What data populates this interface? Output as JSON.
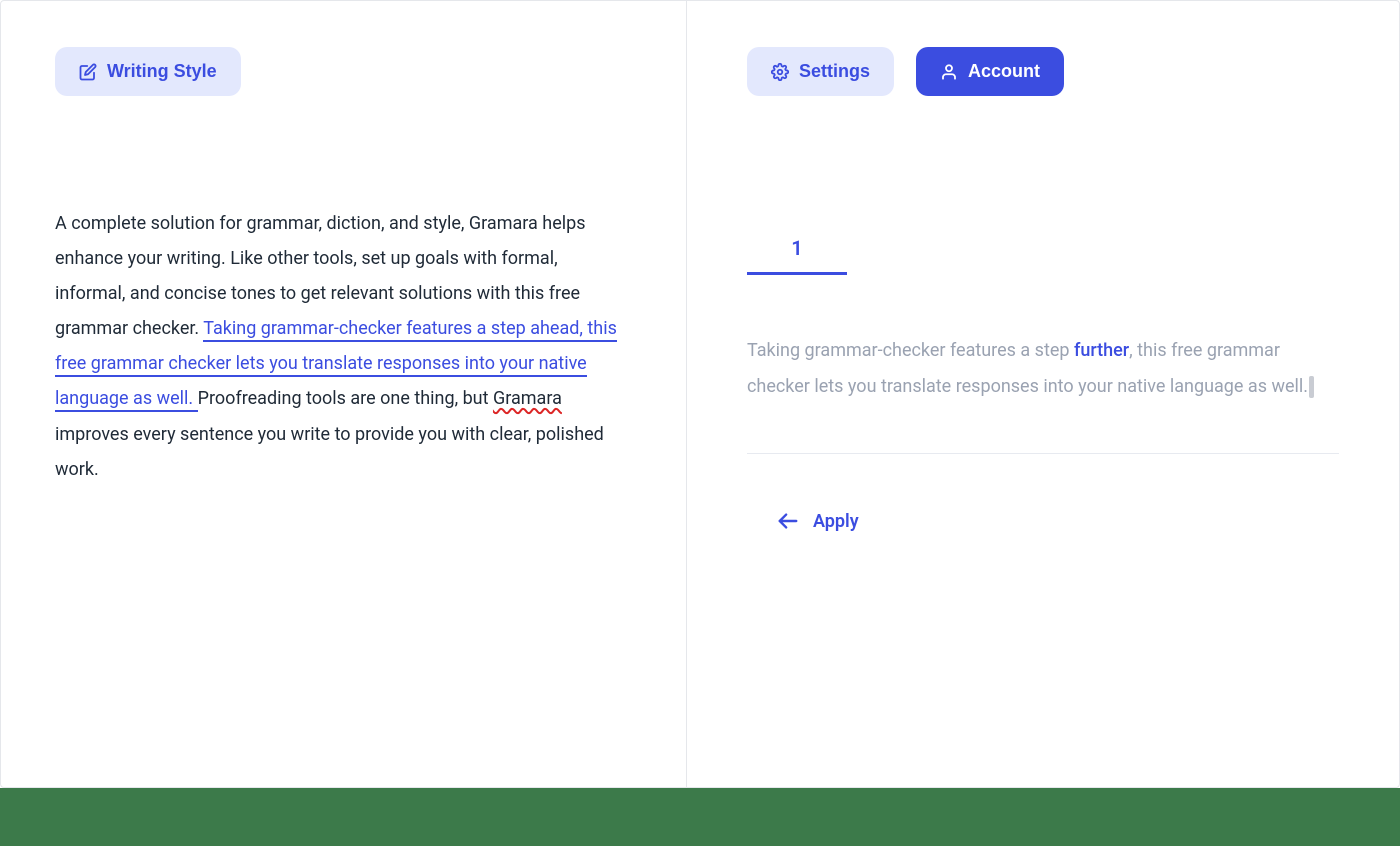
{
  "left": {
    "writing_style_label": "Writing Style",
    "paragraph_pre": "A complete solution for grammar, diction, and style, Gramara helps enhance your writing. Like other tools, set up goals with formal, informal, and concise tones to get relevant solutions with this free grammar checker. ",
    "paragraph_highlight": "Taking grammar-checker features a step ahead, this free grammar checker lets you translate responses into your native language as well. ",
    "paragraph_post_1": "Proofreading tools are one thing, but ",
    "paragraph_squiggle": "Gramara",
    "paragraph_post_2": " improves every sentence you write to provide you with clear, polished work."
  },
  "right": {
    "settings_label": "Settings",
    "account_label": "Account",
    "tab_label": "1",
    "suggestion_pre": "Taking grammar-checker features a step ",
    "suggestion_changed": "further",
    "suggestion_post": ", this free grammar checker lets you translate responses into your native language as well.",
    "apply_label": "Apply"
  }
}
